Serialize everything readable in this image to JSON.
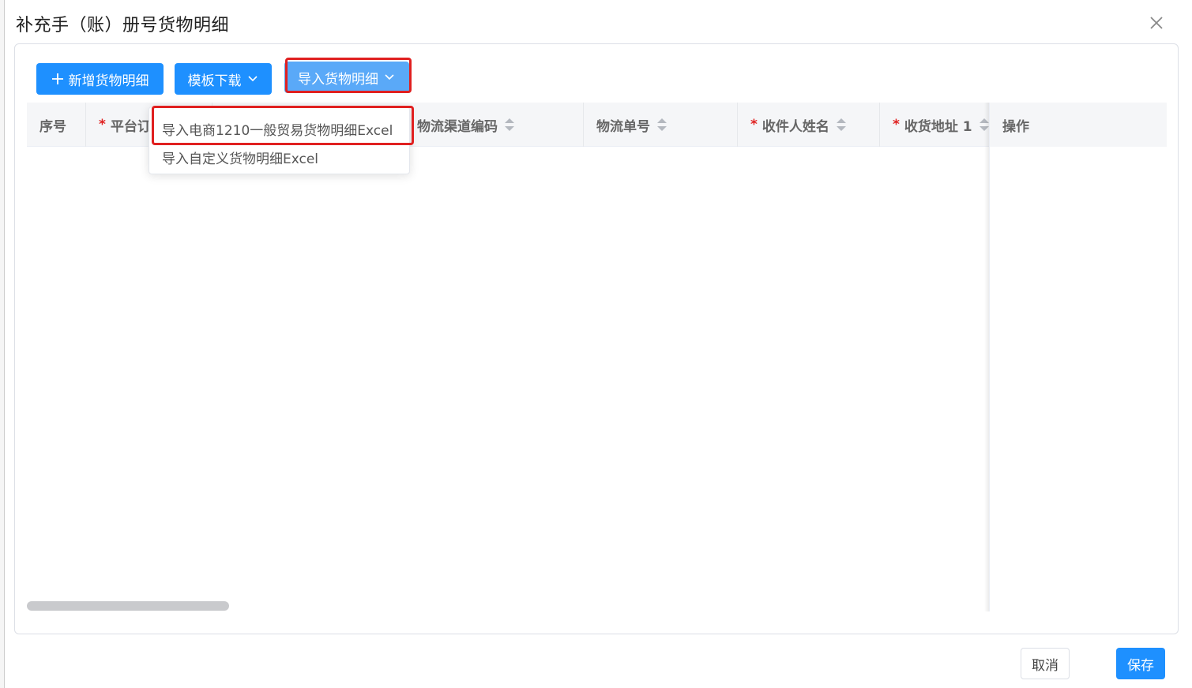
{
  "dialog": {
    "title": "补充手（账）册号货物明细"
  },
  "toolbar": {
    "add_label": "新增货物明细",
    "template_label": "模板下载",
    "import_label": "导入货物明细"
  },
  "import_menu": {
    "items": [
      {
        "label": "导入电商1210一般贸易货物明细Excel"
      },
      {
        "label": "导入自定义货物明细Excel"
      }
    ]
  },
  "table": {
    "columns": [
      {
        "label": "序号",
        "required": false,
        "sortable": false
      },
      {
        "label": "平台订",
        "required": true,
        "sortable": false
      },
      {
        "label": "物流渠道编码",
        "required": false,
        "sortable": true
      },
      {
        "label": "物流单号",
        "required": false,
        "sortable": true
      },
      {
        "label": "收件人姓名",
        "required": true,
        "sortable": true
      },
      {
        "label": "收货地址 1",
        "required": true,
        "sortable": true
      }
    ],
    "fixed_column": {
      "label": "操作"
    },
    "required_mark": "*"
  },
  "footer": {
    "cancel_label": "取消",
    "save_label": "保存"
  },
  "colors": {
    "primary": "#1e90ff",
    "highlight": "#e02020",
    "required": "#e02020"
  }
}
